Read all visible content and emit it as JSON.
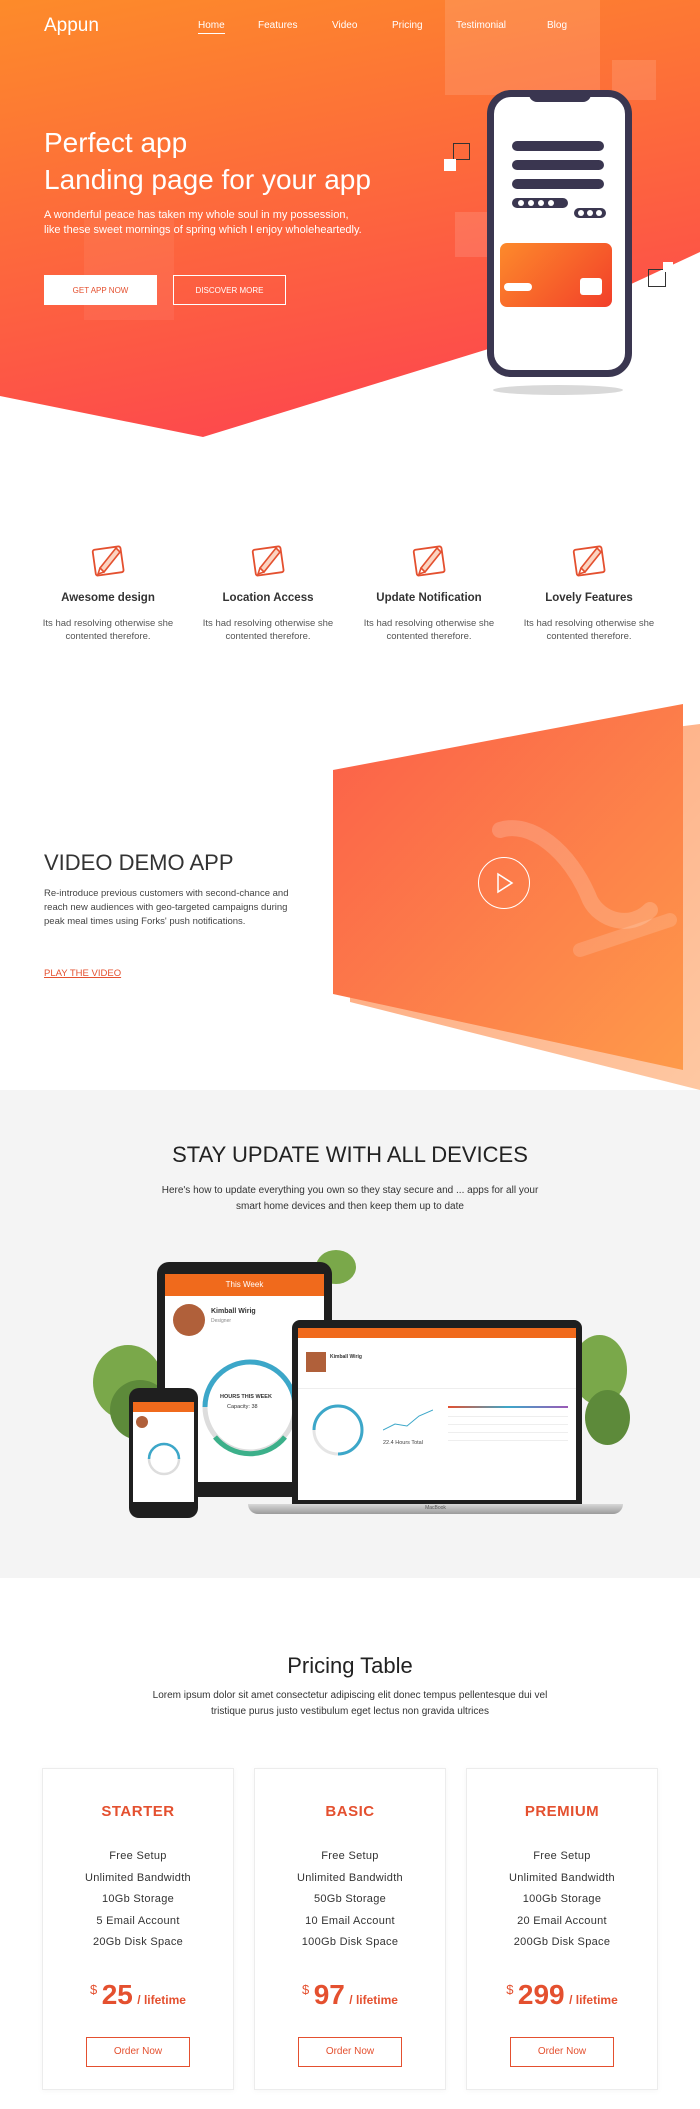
{
  "header": {
    "logo": "Appun",
    "nav": [
      {
        "label": "Home",
        "active": true
      },
      {
        "label": "Features"
      },
      {
        "label": "Video"
      },
      {
        "label": "Pricing"
      },
      {
        "label": "Testimonial"
      },
      {
        "label": "Blog"
      }
    ]
  },
  "hero": {
    "title_line1": "Perfect app",
    "title_line2": "Landing page for your app",
    "description": "A wonderful peace has taken my whole soul in my possession, like these sweet mornings of spring which I enjoy wholeheartedly.",
    "primary_button": "GET APP NOW",
    "secondary_button": "DISCOVER MORE"
  },
  "features": [
    {
      "title": "Awesome design",
      "description": "Its had resolving otherwise she contented therefore.",
      "icon": "pencil-ruler-icon"
    },
    {
      "title": "Location Access",
      "description": "Its had resolving otherwise she contented therefore.",
      "icon": "pencil-ruler-icon"
    },
    {
      "title": "Update Notification",
      "description": "Its had resolving otherwise she contented therefore.",
      "icon": "pencil-ruler-icon"
    },
    {
      "title": "Lovely Features",
      "description": "Its had resolving otherwise she contented therefore.",
      "icon": "pencil-ruler-icon"
    }
  ],
  "video": {
    "title": "VIDEO DEMO APP",
    "description": "Re-introduce previous customers with second-chance and reach new audiences with geo-targeted campaigns during peak meal times using Forks' push notifications.",
    "link": "PLAY THE VIDEO"
  },
  "devices": {
    "title": "STAY UPDATE WITH ALL DEVICES",
    "description": "Here's how to update everything you own so they stay secure and ... apps for all your smart home devices and then keep them up to date",
    "tablet_header": "This Week",
    "tablet_name": "Kimball Wirig",
    "tablet_role": "Designer",
    "tablet_gauge": "HOURS THIS WEEK",
    "tablet_capacity": "Capacity: 38",
    "laptop_name": "Kimball Wirig",
    "laptop_total": "22.4 Hours Total",
    "laptop_brand": "MacBook"
  },
  "pricing": {
    "title": "Pricing Table",
    "description": "Lorem ipsum dolor sit amet consectetur adipiscing elit donec tempus pellentesque dui vel tristique purus justo vestibulum eget lectus non gravida ultrices",
    "plans": [
      {
        "name": "STARTER",
        "features": [
          "Free Setup",
          "Unlimited Bandwidth",
          "10Gb Storage",
          "5 Email Account",
          "20Gb Disk Space"
        ],
        "currency": "$",
        "price": "25",
        "period": "/ lifetime",
        "button": "Order Now"
      },
      {
        "name": "BASIC",
        "features": [
          "Free Setup",
          "Unlimited Bandwidth",
          "50Gb Storage",
          "10 Email Account",
          "100Gb Disk Space"
        ],
        "currency": "$",
        "price": "97",
        "period": "/ lifetime",
        "button": "Order Now"
      },
      {
        "name": "PREMIUM",
        "features": [
          "Free Setup",
          "Unlimited Bandwidth",
          "100Gb Storage",
          "20 Email Account",
          "200Gb Disk Space"
        ],
        "currency": "$",
        "price": "299",
        "period": "/ lifetime",
        "button": "Order Now"
      }
    ]
  },
  "colors": {
    "accent": "#e4502f",
    "gradient_start": "#fd8b2a",
    "gradient_end": "#fd4a4c",
    "dark": "#3a3650"
  }
}
